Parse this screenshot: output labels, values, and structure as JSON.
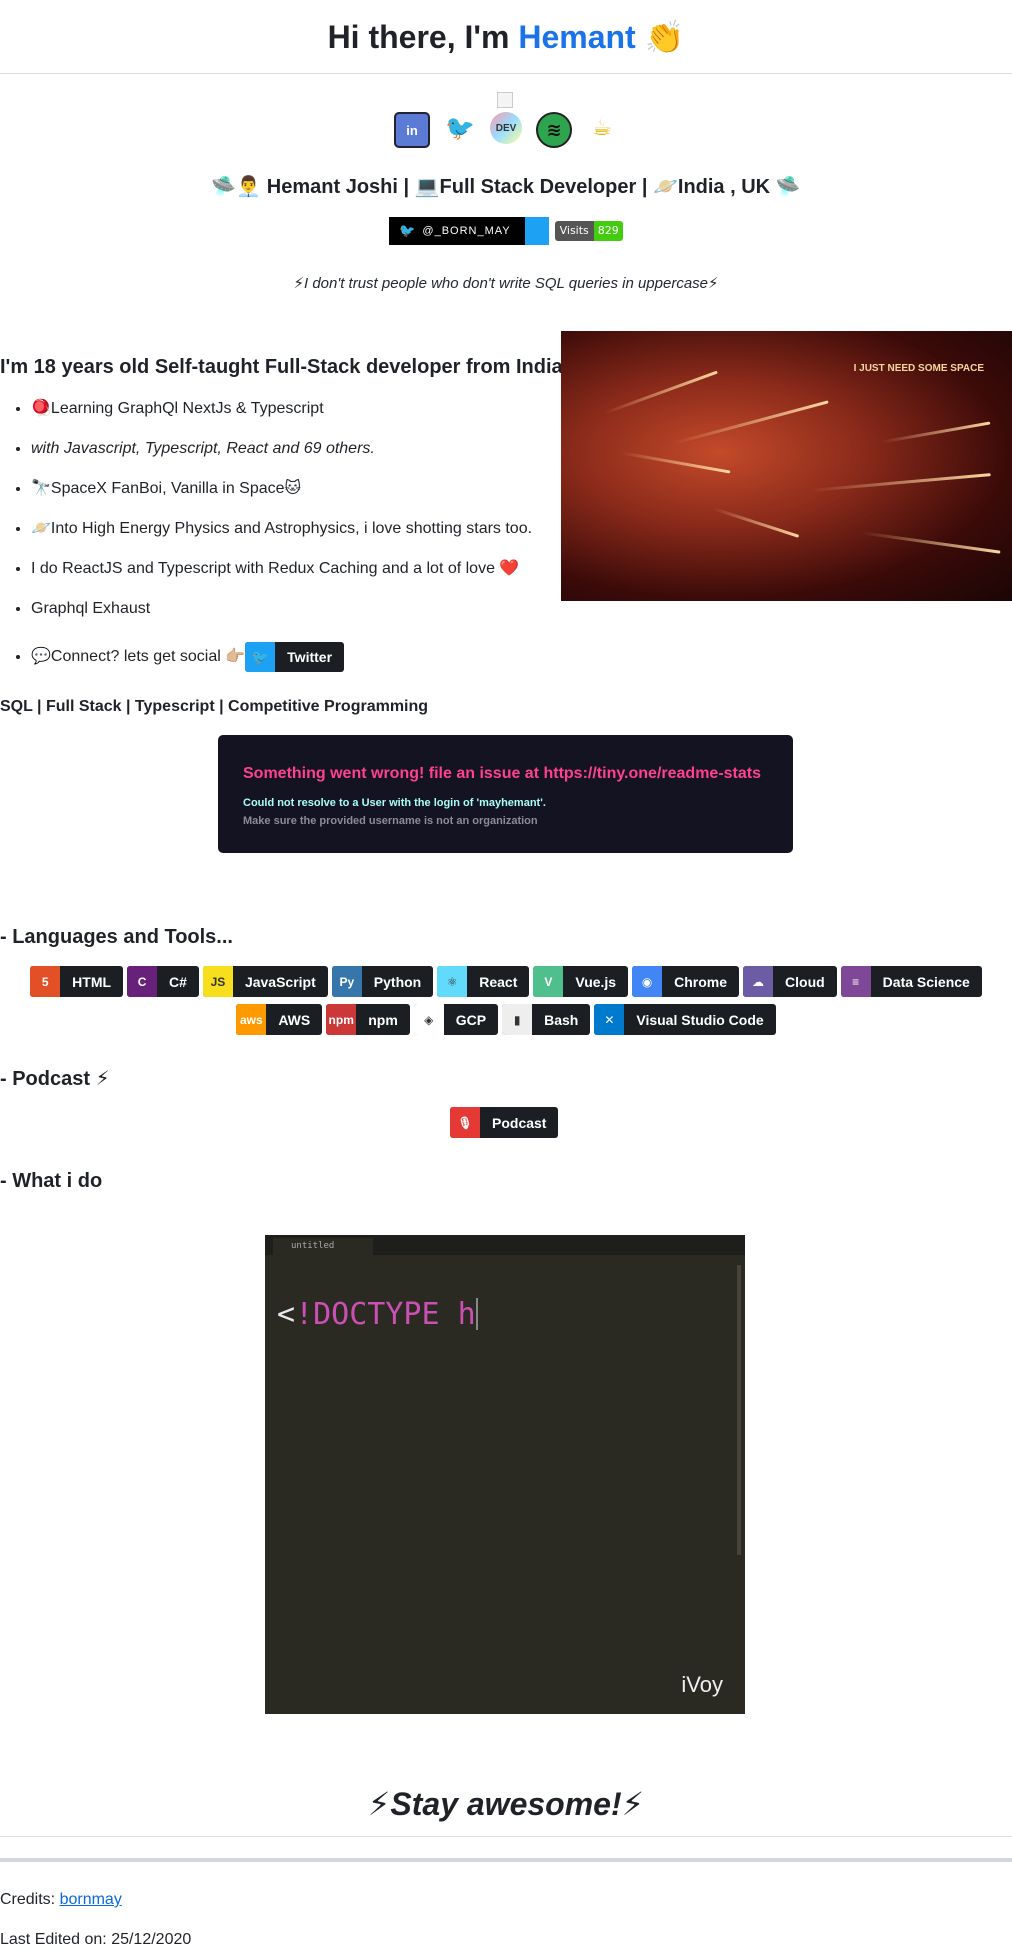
{
  "header": {
    "greeting": "Hi there, I'm",
    "name": "Hemant",
    "wave": "👏"
  },
  "social_icons": [
    {
      "name": "linkedin-icon",
      "label": "in"
    },
    {
      "name": "twitter-icon",
      "label": "🐦"
    },
    {
      "name": "dev-icon",
      "label": "DEV"
    },
    {
      "name": "spotify-icon",
      "label": "≋"
    },
    {
      "name": "coffee-icon",
      "label": "☕"
    }
  ],
  "subtitle": "🛸👨‍💼 Hemant Joshi | 💻Full Stack Developer | 🪐India , UK 🛸",
  "twitter_badge": {
    "label": "@_BORN_MAY"
  },
  "visits_badge": {
    "key": "Visits",
    "value": "829"
  },
  "quote": "⚡I don't trust people who don't write SQL queries in uppercase⚡",
  "intro": "I'm 18 years old Self-taught Full-Stack developer from India.",
  "hero_text": "I JUST NEED SOME SPACE",
  "about": [
    "🪀Learning GraphQl NextJs & Typescript",
    "with Javascript, Typescript, React and 69 others.",
    "🔭SpaceX FanBoi, Vanilla in Space🐱",
    "🪐Into High Energy Physics and Astrophysics, i love shotting stars too.",
    "I do ReactJS and Typescript with Redux Caching and a lot of love ❤️",
    "Graphql Exhaust",
    "💬Connect? lets get social 👉🏼"
  ],
  "twitter_button": "Twitter",
  "skills_line": "SQL | Full Stack | Typescript | Competitive Programming",
  "error_card": {
    "title": "Something went wrong! file an issue at https://tiny.one/readme-stats",
    "line1": "Could not resolve to a User with the login of 'mayhemant'.",
    "line2": "Make sure the provided username is not an organization"
  },
  "sections": {
    "languages": "- Languages and Tools...",
    "podcast": "- Podcast ⚡",
    "what": "- What i do"
  },
  "tools_row1": [
    {
      "label": "HTML",
      "icon": "5",
      "color": "#e34f26",
      "name": "html-icon"
    },
    {
      "label": "C#",
      "icon": "C",
      "color": "#68217a",
      "name": "csharp-icon"
    },
    {
      "label": "JavaScript",
      "icon": "JS",
      "color": "#f7df1e",
      "name": "javascript-icon"
    },
    {
      "label": "Python",
      "icon": "Py",
      "color": "#3776ab",
      "name": "python-icon"
    },
    {
      "label": "React",
      "icon": "⚛",
      "color": "#61dafb",
      "name": "react-icon"
    },
    {
      "label": "Vue.js",
      "icon": "V",
      "color": "#4fc08d",
      "name": "vue-icon"
    },
    {
      "label": "Chrome",
      "icon": "◉",
      "color": "#4285f4",
      "name": "chrome-icon"
    },
    {
      "label": "Cloud",
      "icon": "☁",
      "color": "#6c5ba5",
      "name": "cloud-icon"
    },
    {
      "label": "Data Science",
      "icon": "≡",
      "color": "#7e4798",
      "name": "database-icon"
    }
  ],
  "tools_row2": [
    {
      "label": "AWS",
      "icon": "aws",
      "color": "#ff9900",
      "name": "aws-icon"
    },
    {
      "label": "npm",
      "icon": "npm",
      "color": "#cb3837",
      "name": "npm-icon"
    },
    {
      "label": "GCP",
      "icon": "◈",
      "color": "#ffffff",
      "name": "gcp-icon"
    },
    {
      "label": "Bash",
      "icon": "▮",
      "color": "#eeeeee",
      "name": "bash-icon"
    },
    {
      "label": "Visual Studio Code",
      "icon": "✕",
      "color": "#007acc",
      "name": "vscode-icon"
    }
  ],
  "podcast_button": "Podcast",
  "editor": {
    "tab": "untitled",
    "code_lt": "<",
    "code_rest": "!DOCTYPE h",
    "brand": "iVoy"
  },
  "footer": {
    "awesome": "⚡Stay awesome!⚡",
    "credits_label": "Credits:",
    "credits_link": "bornmay",
    "edited": "Last Edited on: 25/12/2020"
  }
}
